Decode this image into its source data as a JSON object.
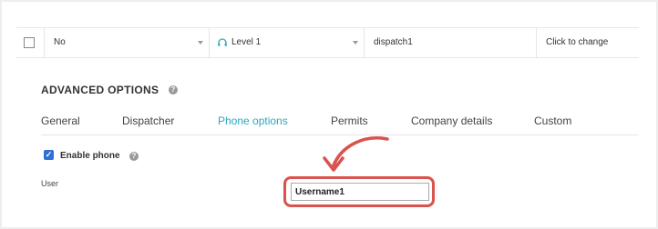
{
  "table_row": {
    "checkbox_checked": false,
    "cells": [
      {
        "value": "No"
      },
      {
        "value": "Level 1",
        "icon": "headset-icon"
      },
      {
        "value": "dispatch1"
      },
      {
        "value": "Click to change"
      }
    ]
  },
  "advanced": {
    "title": "ADVANCED OPTIONS",
    "help_glyph": "?"
  },
  "tabs": [
    {
      "label": "General",
      "active": false
    },
    {
      "label": "Dispatcher",
      "active": false
    },
    {
      "label": "Phone options",
      "active": true
    },
    {
      "label": "Permits",
      "active": false
    },
    {
      "label": "Company details",
      "active": false
    },
    {
      "label": "Custom",
      "active": false
    }
  ],
  "phone": {
    "enable_label": "Enable phone",
    "enable_checked": true,
    "help_glyph": "?",
    "user_label": "User",
    "user_value": "Username1"
  },
  "colors": {
    "accent": "#2ea8b8",
    "highlight": "#d9534f",
    "checkbox": "#2f6fd6"
  }
}
